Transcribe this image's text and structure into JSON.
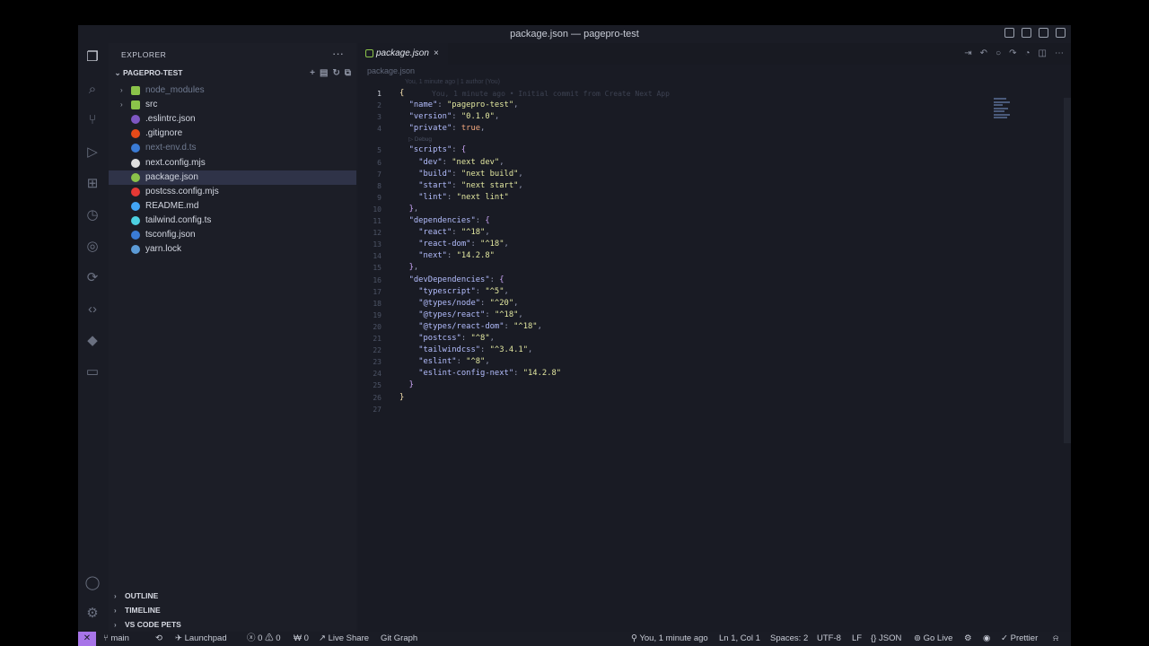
{
  "window": {
    "title": "package.json — pagepro-test"
  },
  "activity_bar": {
    "icons": [
      "files-icon",
      "search-icon",
      "source-control-icon",
      "run-debug-icon",
      "extensions-icon",
      "git-graph-icon",
      "remote-icon",
      "live-share-icon",
      "code-icon",
      "docker-icon",
      "preview-icon"
    ],
    "bottom_icons": [
      "account-icon",
      "settings-gear-icon"
    ]
  },
  "sidebar": {
    "header": "EXPLORER",
    "more": "···",
    "project": "PAGEPRO-TEST",
    "items": [
      {
        "label": "node_modules",
        "kind": "folder",
        "color": "#8bc34a",
        "dim": true
      },
      {
        "label": "src",
        "kind": "folder",
        "color": "#8bc34a",
        "dim": false
      },
      {
        "label": ".eslintrc.json",
        "kind": "file",
        "color": "#7e57c2",
        "dim": false
      },
      {
        "label": ".gitignore",
        "kind": "file",
        "color": "#e64a19",
        "dim": false
      },
      {
        "label": "next-env.d.ts",
        "kind": "file",
        "color": "#3a7bd5",
        "dim": true
      },
      {
        "label": "next.config.mjs",
        "kind": "file",
        "color": "#e0e0e0",
        "dim": false
      },
      {
        "label": "package.json",
        "kind": "file",
        "color": "#8bc34a",
        "dim": false,
        "selected": true
      },
      {
        "label": "postcss.config.mjs",
        "kind": "file",
        "color": "#e53935",
        "dim": false
      },
      {
        "label": "README.md",
        "kind": "file",
        "color": "#42a5f5",
        "dim": false
      },
      {
        "label": "tailwind.config.ts",
        "kind": "file",
        "color": "#4dd0e1",
        "dim": false
      },
      {
        "label": "tsconfig.json",
        "kind": "file",
        "color": "#3a7bd5",
        "dim": false
      },
      {
        "label": "yarn.lock",
        "kind": "file",
        "color": "#5c9bd6",
        "dim": false
      }
    ],
    "sections": [
      "OUTLINE",
      "TIMELINE",
      "VS CODE PETS"
    ]
  },
  "editor": {
    "tab": {
      "label": "package.json",
      "close": "×"
    },
    "breadcrumb": "package.json",
    "blame_header": "You, 1 minute ago | 1 author (You)",
    "inline_blame": "You, 1 minute ago • Initial commit from Create Next App",
    "codelens": "▷ Debug",
    "lines": [
      {
        "n": "1",
        "parts": [
          [
            "br",
            "{"
          ]
        ]
      },
      {
        "n": "2",
        "parts": [
          [
            "ind",
            "  "
          ],
          [
            "key",
            "\"name\""
          ],
          [
            "pun",
            ": "
          ],
          [
            "str",
            "\"pagepro-test\""
          ],
          [
            "pun",
            ","
          ]
        ]
      },
      {
        "n": "3",
        "parts": [
          [
            "ind",
            "  "
          ],
          [
            "key",
            "\"version\""
          ],
          [
            "pun",
            ": "
          ],
          [
            "str",
            "\"0.1.0\""
          ],
          [
            "pun",
            ","
          ]
        ]
      },
      {
        "n": "4",
        "parts": [
          [
            "ind",
            "  "
          ],
          [
            "key",
            "\"private\""
          ],
          [
            "pun",
            ": "
          ],
          [
            "kw",
            "true"
          ],
          [
            "pun",
            ","
          ]
        ]
      },
      {
        "n": "5",
        "parts": [
          [
            "ind",
            "  "
          ],
          [
            "key",
            "\"scripts\""
          ],
          [
            "pun",
            ": "
          ],
          [
            "br2",
            "{"
          ]
        ]
      },
      {
        "n": "6",
        "parts": [
          [
            "ind",
            "    "
          ],
          [
            "key",
            "\"dev\""
          ],
          [
            "pun",
            ": "
          ],
          [
            "str",
            "\"next dev\""
          ],
          [
            "pun",
            ","
          ]
        ]
      },
      {
        "n": "7",
        "parts": [
          [
            "ind",
            "    "
          ],
          [
            "key",
            "\"build\""
          ],
          [
            "pun",
            ": "
          ],
          [
            "str",
            "\"next build\""
          ],
          [
            "pun",
            ","
          ]
        ]
      },
      {
        "n": "8",
        "parts": [
          [
            "ind",
            "    "
          ],
          [
            "key",
            "\"start\""
          ],
          [
            "pun",
            ": "
          ],
          [
            "str",
            "\"next start\""
          ],
          [
            "pun",
            ","
          ]
        ]
      },
      {
        "n": "9",
        "parts": [
          [
            "ind",
            "    "
          ],
          [
            "key",
            "\"lint\""
          ],
          [
            "pun",
            ": "
          ],
          [
            "str",
            "\"next lint\""
          ]
        ]
      },
      {
        "n": "10",
        "parts": [
          [
            "ind",
            "  "
          ],
          [
            "br2",
            "}"
          ],
          [
            "pun",
            ","
          ]
        ]
      },
      {
        "n": "11",
        "parts": [
          [
            "ind",
            "  "
          ],
          [
            "key",
            "\"dependencies\""
          ],
          [
            "pun",
            ": "
          ],
          [
            "br2",
            "{"
          ]
        ]
      },
      {
        "n": "12",
        "parts": [
          [
            "ind",
            "    "
          ],
          [
            "key",
            "\"react\""
          ],
          [
            "pun",
            ": "
          ],
          [
            "str",
            "\"^18\""
          ],
          [
            "pun",
            ","
          ]
        ]
      },
      {
        "n": "13",
        "parts": [
          [
            "ind",
            "    "
          ],
          [
            "key",
            "\"react-dom\""
          ],
          [
            "pun",
            ": "
          ],
          [
            "str",
            "\"^18\""
          ],
          [
            "pun",
            ","
          ]
        ]
      },
      {
        "n": "14",
        "parts": [
          [
            "ind",
            "    "
          ],
          [
            "key",
            "\"next\""
          ],
          [
            "pun",
            ": "
          ],
          [
            "str",
            "\"14.2.8\""
          ]
        ]
      },
      {
        "n": "15",
        "parts": [
          [
            "ind",
            "  "
          ],
          [
            "br2",
            "}"
          ],
          [
            "pun",
            ","
          ]
        ]
      },
      {
        "n": "16",
        "parts": [
          [
            "ind",
            "  "
          ],
          [
            "key",
            "\"devDependencies\""
          ],
          [
            "pun",
            ": "
          ],
          [
            "br2",
            "{"
          ]
        ]
      },
      {
        "n": "17",
        "parts": [
          [
            "ind",
            "    "
          ],
          [
            "key",
            "\"typescript\""
          ],
          [
            "pun",
            ": "
          ],
          [
            "str",
            "\"^5\""
          ],
          [
            "pun",
            ","
          ]
        ]
      },
      {
        "n": "18",
        "parts": [
          [
            "ind",
            "    "
          ],
          [
            "key",
            "\"@types/node\""
          ],
          [
            "pun",
            ": "
          ],
          [
            "str",
            "\"^20\""
          ],
          [
            "pun",
            ","
          ]
        ]
      },
      {
        "n": "19",
        "parts": [
          [
            "ind",
            "    "
          ],
          [
            "key",
            "\"@types/react\""
          ],
          [
            "pun",
            ": "
          ],
          [
            "str",
            "\"^18\""
          ],
          [
            "pun",
            ","
          ]
        ]
      },
      {
        "n": "20",
        "parts": [
          [
            "ind",
            "    "
          ],
          [
            "key",
            "\"@types/react-dom\""
          ],
          [
            "pun",
            ": "
          ],
          [
            "str",
            "\"^18\""
          ],
          [
            "pun",
            ","
          ]
        ]
      },
      {
        "n": "21",
        "parts": [
          [
            "ind",
            "    "
          ],
          [
            "key",
            "\"postcss\""
          ],
          [
            "pun",
            ": "
          ],
          [
            "str",
            "\"^8\""
          ],
          [
            "pun",
            ","
          ]
        ]
      },
      {
        "n": "22",
        "parts": [
          [
            "ind",
            "    "
          ],
          [
            "key",
            "\"tailwindcss\""
          ],
          [
            "pun",
            ": "
          ],
          [
            "str",
            "\"^3.4.1\""
          ],
          [
            "pun",
            ","
          ]
        ]
      },
      {
        "n": "23",
        "parts": [
          [
            "ind",
            "    "
          ],
          [
            "key",
            "\"eslint\""
          ],
          [
            "pun",
            ": "
          ],
          [
            "str",
            "\"^8\""
          ],
          [
            "pun",
            ","
          ]
        ]
      },
      {
        "n": "24",
        "parts": [
          [
            "ind",
            "    "
          ],
          [
            "key",
            "\"eslint-config-next\""
          ],
          [
            "pun",
            ": "
          ],
          [
            "str",
            "\"14.2.8\""
          ]
        ]
      },
      {
        "n": "25",
        "parts": [
          [
            "ind",
            "  "
          ],
          [
            "br2",
            "}"
          ]
        ]
      },
      {
        "n": "26",
        "parts": [
          [
            "br",
            "}"
          ]
        ]
      },
      {
        "n": "27",
        "parts": []
      }
    ]
  },
  "statusbar": {
    "remote": "✕",
    "branch": "main",
    "launchpad": "Launchpad",
    "problems_errors": "0",
    "problems_warnings": "0",
    "ports": "0",
    "live_share": "Live Share",
    "git_graph": "Git Graph",
    "blame": "You, 1 minute ago",
    "cursor": "Ln 1, Col 1",
    "spaces": "Spaces: 2",
    "encoding": "UTF-8",
    "eol": "LF",
    "language": "JSON",
    "go_live": "Go Live",
    "prettier": "Prettier"
  }
}
